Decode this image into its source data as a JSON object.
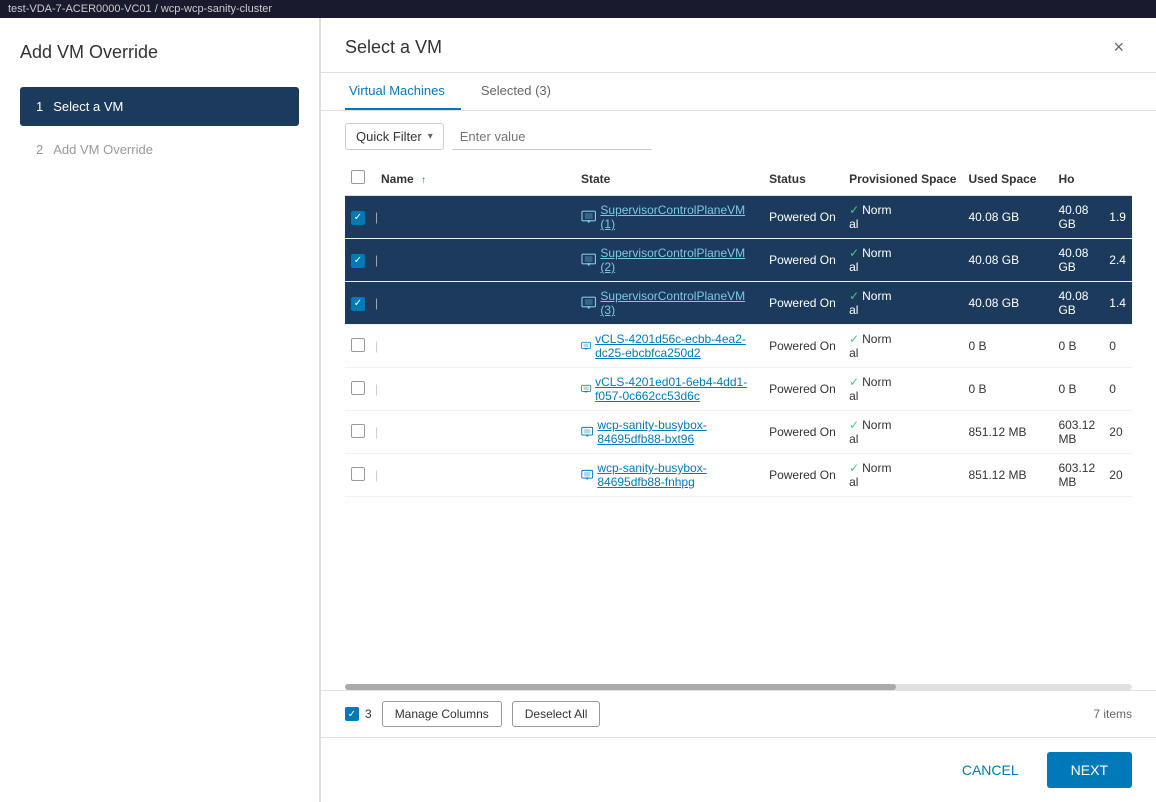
{
  "topbar": {
    "text": "test-VDA-7-ACER0000-VC01 / wcp-wcp-sanity-cluster"
  },
  "leftPanel": {
    "title": "Add VM Override",
    "steps": [
      {
        "number": "1",
        "label": "Select a VM",
        "active": true
      },
      {
        "number": "2",
        "label": "Add VM Override",
        "active": false
      }
    ]
  },
  "dialog": {
    "title": "Select a VM",
    "close_label": "×",
    "tabs": [
      {
        "label": "Virtual Machines",
        "active": true
      },
      {
        "label": "Selected (3)",
        "active": false
      }
    ],
    "filter": {
      "quick_filter_label": "Quick Filter",
      "enter_value_placeholder": "Enter value"
    },
    "table": {
      "columns": [
        {
          "key": "name",
          "label": "Name",
          "sortable": true
        },
        {
          "key": "state",
          "label": "State",
          "sortable": false
        },
        {
          "key": "status",
          "label": "Status",
          "sortable": false
        },
        {
          "key": "provisioned_space",
          "label": "Provisioned Space",
          "sortable": false
        },
        {
          "key": "used_space",
          "label": "Used Space",
          "sortable": false
        },
        {
          "key": "ho",
          "label": "Ho",
          "sortable": false
        }
      ],
      "rows": [
        {
          "id": 1,
          "selected": true,
          "name": "SupervisorControlPlaneVM (1)",
          "state": "Powered On",
          "status": "Normal",
          "provisioned_space": "40.08 GB",
          "used_space": "40.08 GB",
          "ho": "1.9"
        },
        {
          "id": 2,
          "selected": true,
          "name": "SupervisorControlPlaneVM (2)",
          "state": "Powered On",
          "status": "Normal",
          "provisioned_space": "40.08 GB",
          "used_space": "40.08 GB",
          "ho": "2.4"
        },
        {
          "id": 3,
          "selected": true,
          "name": "SupervisorControlPlaneVM (3)",
          "state": "Powered On",
          "status": "Normal",
          "provisioned_space": "40.08 GB",
          "used_space": "40.08 GB",
          "ho": "1.4"
        },
        {
          "id": 4,
          "selected": false,
          "name": "vCLS-4201d56c-ecbb-4ea2-dc25-ebcbfca250d2",
          "state": "Powered On",
          "status": "Normal",
          "provisioned_space": "0 B",
          "used_space": "0 B",
          "ho": "0"
        },
        {
          "id": 5,
          "selected": false,
          "name": "vCLS-4201ed01-6eb4-4dd1-f057-0c662cc53d6c",
          "state": "Powered On",
          "status": "Normal",
          "provisioned_space": "0 B",
          "used_space": "0 B",
          "ho": "0"
        },
        {
          "id": 6,
          "selected": false,
          "name": "wcp-sanity-busybox-84695dfb88-bxt96",
          "state": "Powered On",
          "status": "Normal",
          "provisioned_space": "851.12 MB",
          "used_space": "603.12 MB",
          "ho": "20"
        },
        {
          "id": 7,
          "selected": false,
          "name": "wcp-sanity-busybox-84695dfb88-fnhpg",
          "state": "Powered On",
          "status": "Normal",
          "provisioned_space": "851.12 MB",
          "used_space": "603.12 MB",
          "ho": "20"
        }
      ]
    },
    "footer": {
      "selected_count": "3",
      "manage_columns_label": "Manage Columns",
      "deselect_all_label": "Deselect All",
      "items_count": "7 items"
    },
    "actions": {
      "cancel_label": "CANCEL",
      "next_label": "NEXT"
    }
  }
}
